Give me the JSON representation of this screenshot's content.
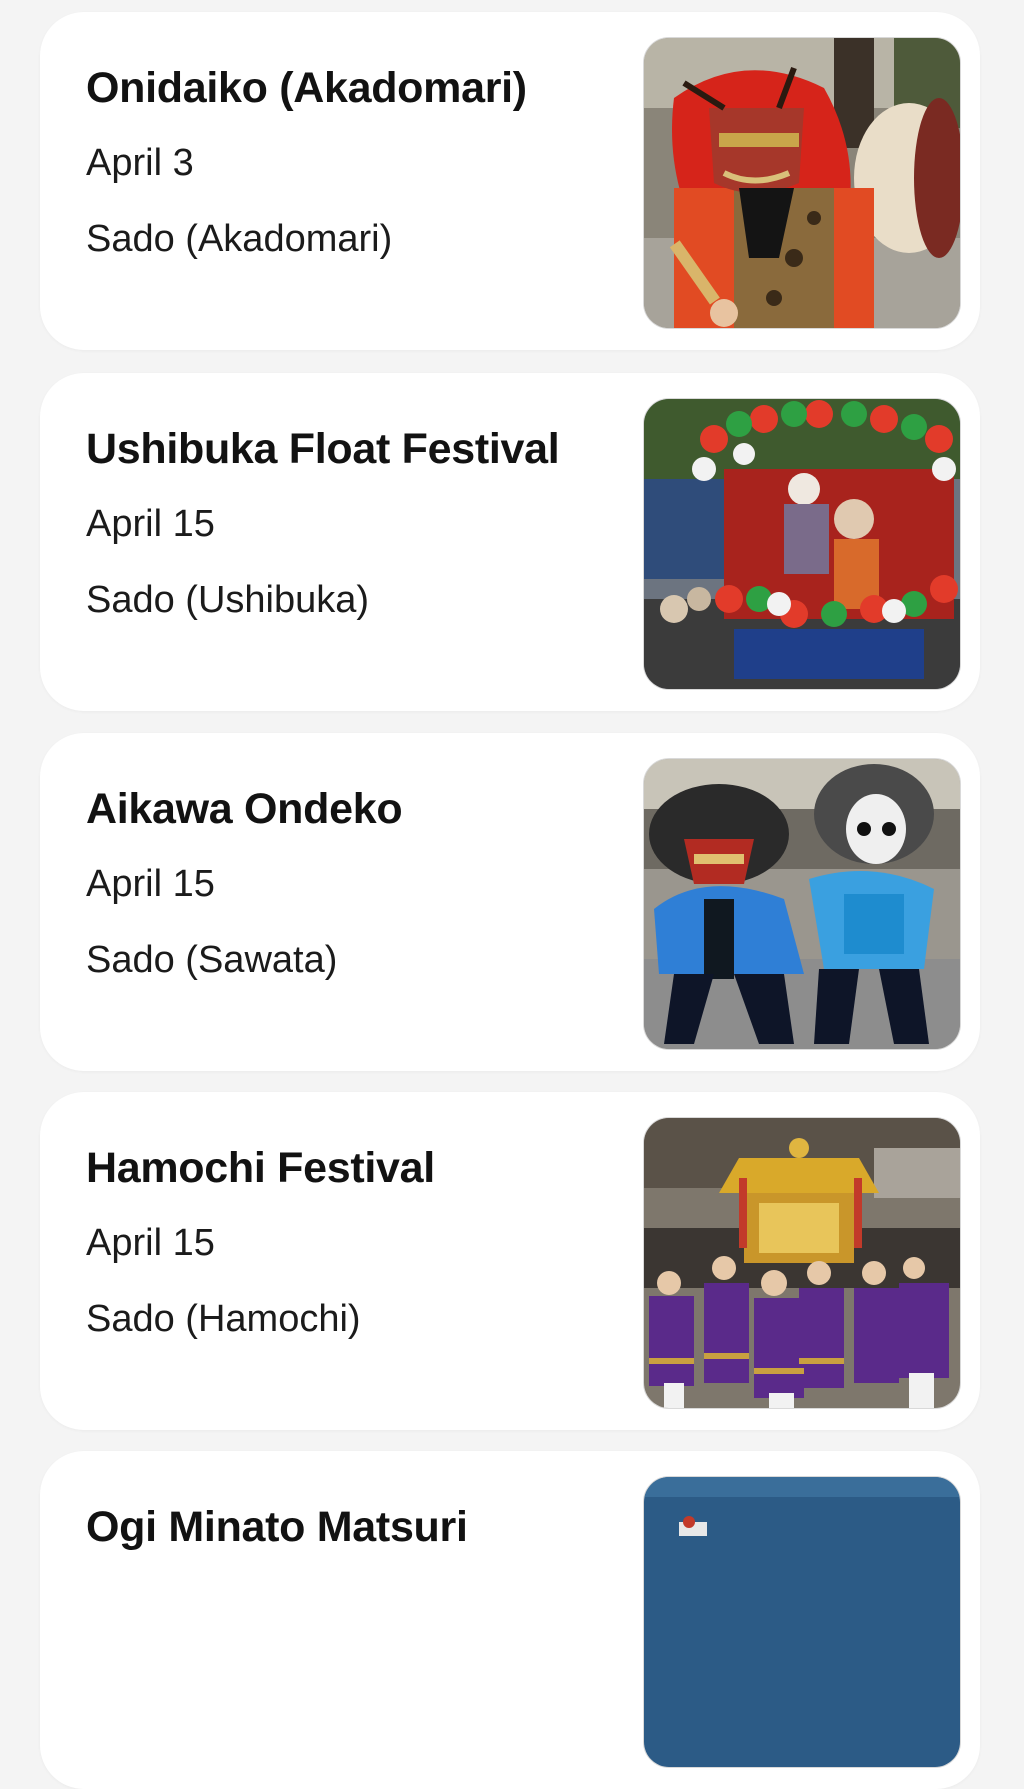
{
  "events": [
    {
      "title": "Onidaiko (Akadomari)",
      "date": "April 3",
      "location": "Sado (Akadomari)",
      "image_icon": "red-oni-mask-drummer"
    },
    {
      "title": "Ushibuka Float Festival",
      "date": "April 15",
      "location": "Sado (Ushibuka)",
      "image_icon": "decorated-festival-float"
    },
    {
      "title": "Aikawa Ondeko",
      "date": "April 15",
      "location": "Sado (Sawata)",
      "image_icon": "masked-dancers"
    },
    {
      "title": "Hamochi Festival",
      "date": "April 15",
      "location": "Sado (Hamochi)",
      "image_icon": "golden-mikoshi-procession"
    },
    {
      "title": "Ogi Minato Matsuri",
      "date": "",
      "location": "",
      "image_icon": "boat-on-sea"
    }
  ]
}
